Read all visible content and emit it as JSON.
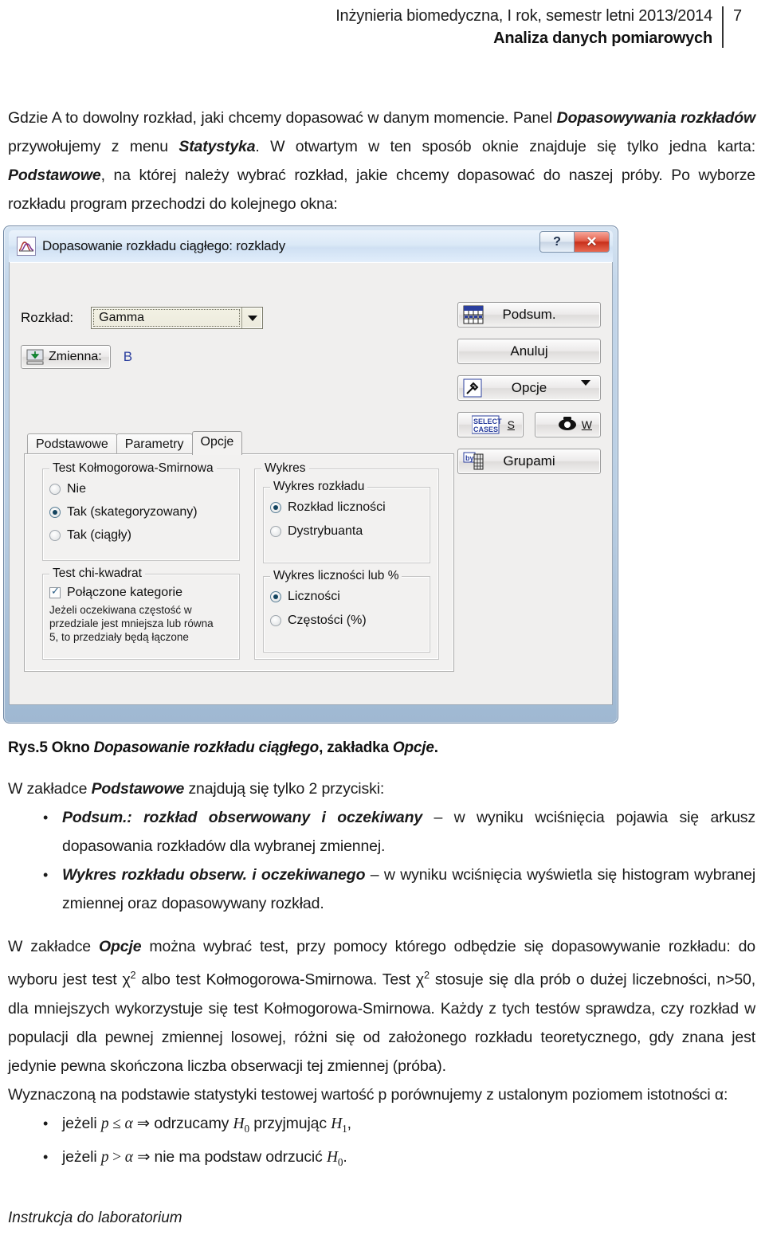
{
  "header": {
    "line1": "Inżynieria biomedyczna, I rok, semestr letni 2013/2014",
    "line2": "Analiza danych pomiarowych",
    "page_number": "7"
  },
  "body": {
    "para1": {
      "t1": "Gdzie A to dowolny rozkład, jaki chcemy dopasować w danym momencie. Panel ",
      "b1": "Dopasowywania rozkładów",
      "t2": " przywołujemy z menu ",
      "b2": "Statystyka",
      "t3": ". W otwartym w ten sposób oknie znajduje się tylko jedna karta: ",
      "b3": "Podstawowe",
      "t4": ", na której należy wybrać rozkład, jakie chcemy dopasować do naszej próby. Po wyborze rozkładu program przechodzi do kolejnego okna:"
    },
    "caption": {
      "t1": "Rys.5 Okno ",
      "i1": "Dopasowanie rozkładu ciągłego",
      "t2": ", zakładka ",
      "i2": "Opcje",
      "t3": "."
    },
    "para2": {
      "t1": "W zakładce ",
      "b1": "Podstawowe",
      "t2": " znajdują się tylko 2 przyciski:"
    },
    "bullets_buttons": [
      {
        "bold": "Podsum.: rozkład obserwowany i oczekiwany",
        "rest": " – w wyniku wciśnięcia pojawia się arkusz dopasowania rozkładów dla wybranej zmiennej."
      },
      {
        "bold": "Wykres rozkładu obserw. i oczekiwanego",
        "rest": " – w wyniku wciśnięcia wyświetla się histogram wybranej zmiennej oraz dopasowywany rozkład."
      }
    ],
    "para3": {
      "t1": "W zakładce ",
      "b1": "Opcje",
      "t2": " można wybrać test, przy pomocy którego odbędzie się dopasowywanie rozkładu: do wyboru jest test χ",
      "sup1": "2",
      "t3": " albo test Kołmogorowa-Smirnowa.  Test χ",
      "sup2": "2",
      "t4": " stosuje się dla prób o dużej liczebności, n>50, dla mniejszych wykorzystuje się test Kołmogorowa-Smirnowa. Każdy z tych testów sprawdza, czy rozkład w populacji dla pewnej zmiennej losowej, różni się od założonego rozkładu teoretycznego, gdy znana jest jedynie pewna skończona liczba obserwacji tej zmiennej (próba)."
    },
    "para4": "Wyznaczoną na podstawie statystyki testowej wartość p porównujemy z ustalonym poziomem istotności α:",
    "bullets_math": [
      {
        "pre": "jeżeli ",
        "p": "p",
        "rel": " ≤ ",
        "alpha": "α",
        "mid": " ⇒ odrzucamy ",
        "h0": "H",
        "h0sub": "0",
        "mid2": " przyjmując ",
        "h1": "H",
        "h1sub": "1",
        "end": ","
      },
      {
        "pre": "jeżeli ",
        "p": "p",
        "rel": " > ",
        "alpha": "α",
        "mid": " ⇒ nie ma podstaw odrzucić ",
        "h0": "H",
        "h0sub": "0",
        "mid2": "",
        "h1": "",
        "h1sub": "",
        "end": "."
      }
    ],
    "footer": "Instrukcja do laboratorium"
  },
  "dialog": {
    "title": "Dopasowanie rozkładu ciągłego: rozklady",
    "titlebar_icon": "distribution-curve-icon",
    "help_button": "?",
    "close_button": "✕",
    "rozklad_label": "Rozkład:",
    "rozklad_value": "Gamma",
    "zmienna_button": "Zmienna:",
    "zmienna_value": "B",
    "buttons": {
      "podsum": "Podsum.",
      "anuluj": "Anuluj",
      "opcje": "Opcje",
      "select_cases": "SELECT CASES",
      "select_cases_mnemonic": "S",
      "print_mnemonic": "W",
      "grupami": "Grupami"
    },
    "tabs": [
      {
        "label": "Podstawowe",
        "active": false
      },
      {
        "label": "Parametry",
        "active": false
      },
      {
        "label": "Opcje",
        "active": true
      }
    ],
    "groups": {
      "ks_test": {
        "title": "Test Kołmogorowa-Smirnowa",
        "options": [
          {
            "label": "Nie",
            "selected": false
          },
          {
            "label": "Tak (skategoryzowany)",
            "selected": true
          },
          {
            "label": "Tak (ciągły)",
            "selected": false
          }
        ]
      },
      "chi2_test": {
        "title": "Test chi-kwadrat",
        "checkbox_label": "Połączone kategorie",
        "checkbox_checked": true,
        "hint": "Jeżeli oczekiwana częstość w przedziale jest mniejsza lub równa 5, to przedziały będą łączone"
      },
      "wykres": {
        "title": "Wykres",
        "sub1": {
          "title": "Wykres rozkładu",
          "options": [
            {
              "label": "Rozkład liczności",
              "selected": true
            },
            {
              "label": "Dystrybuanta",
              "selected": false
            }
          ]
        },
        "sub2": {
          "title": "Wykres liczności lub %",
          "options": [
            {
              "label": "Liczności",
              "selected": true
            },
            {
              "label": "Częstości (%)",
              "selected": false
            }
          ]
        }
      }
    }
  },
  "colors": {
    "title_red": "#c8301b",
    "link_blue": "#2b3f9e",
    "radio_dot": "#14445f"
  }
}
